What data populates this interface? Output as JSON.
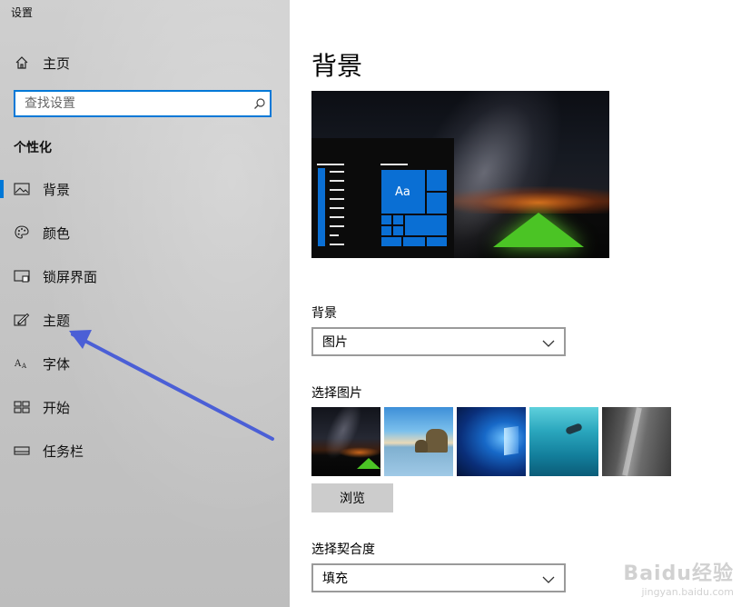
{
  "window": {
    "title": "设置"
  },
  "sidebar": {
    "home_label": "主页",
    "search_placeholder": "查找设置",
    "section_heading": "个性化",
    "items": [
      {
        "label": "背景",
        "icon": "picture-icon",
        "active": true
      },
      {
        "label": "颜色",
        "icon": "palette-icon",
        "active": false
      },
      {
        "label": "锁屏界面",
        "icon": "lock-screen-icon",
        "active": false
      },
      {
        "label": "主题",
        "icon": "theme-brush-icon",
        "active": false
      },
      {
        "label": "字体",
        "icon": "font-icon",
        "active": false
      },
      {
        "label": "开始",
        "icon": "start-grid-icon",
        "active": false
      },
      {
        "label": "任务栏",
        "icon": "taskbar-icon",
        "active": false
      }
    ],
    "annotation_arrow_color": "#4b5fd6"
  },
  "main": {
    "title": "背景",
    "preview": {
      "tile_text": "Aa"
    },
    "background_label": "背景",
    "background_value": "图片",
    "choose_picture_label": "选择图片",
    "browse_label": "浏览",
    "fit_label": "选择契合度",
    "fit_value": "填充"
  },
  "watermark": {
    "main": "Baidu经验",
    "sub": "jingyan.baidu.com"
  },
  "colors": {
    "accent": "#0078d7",
    "tile": "#0a6fd4"
  }
}
